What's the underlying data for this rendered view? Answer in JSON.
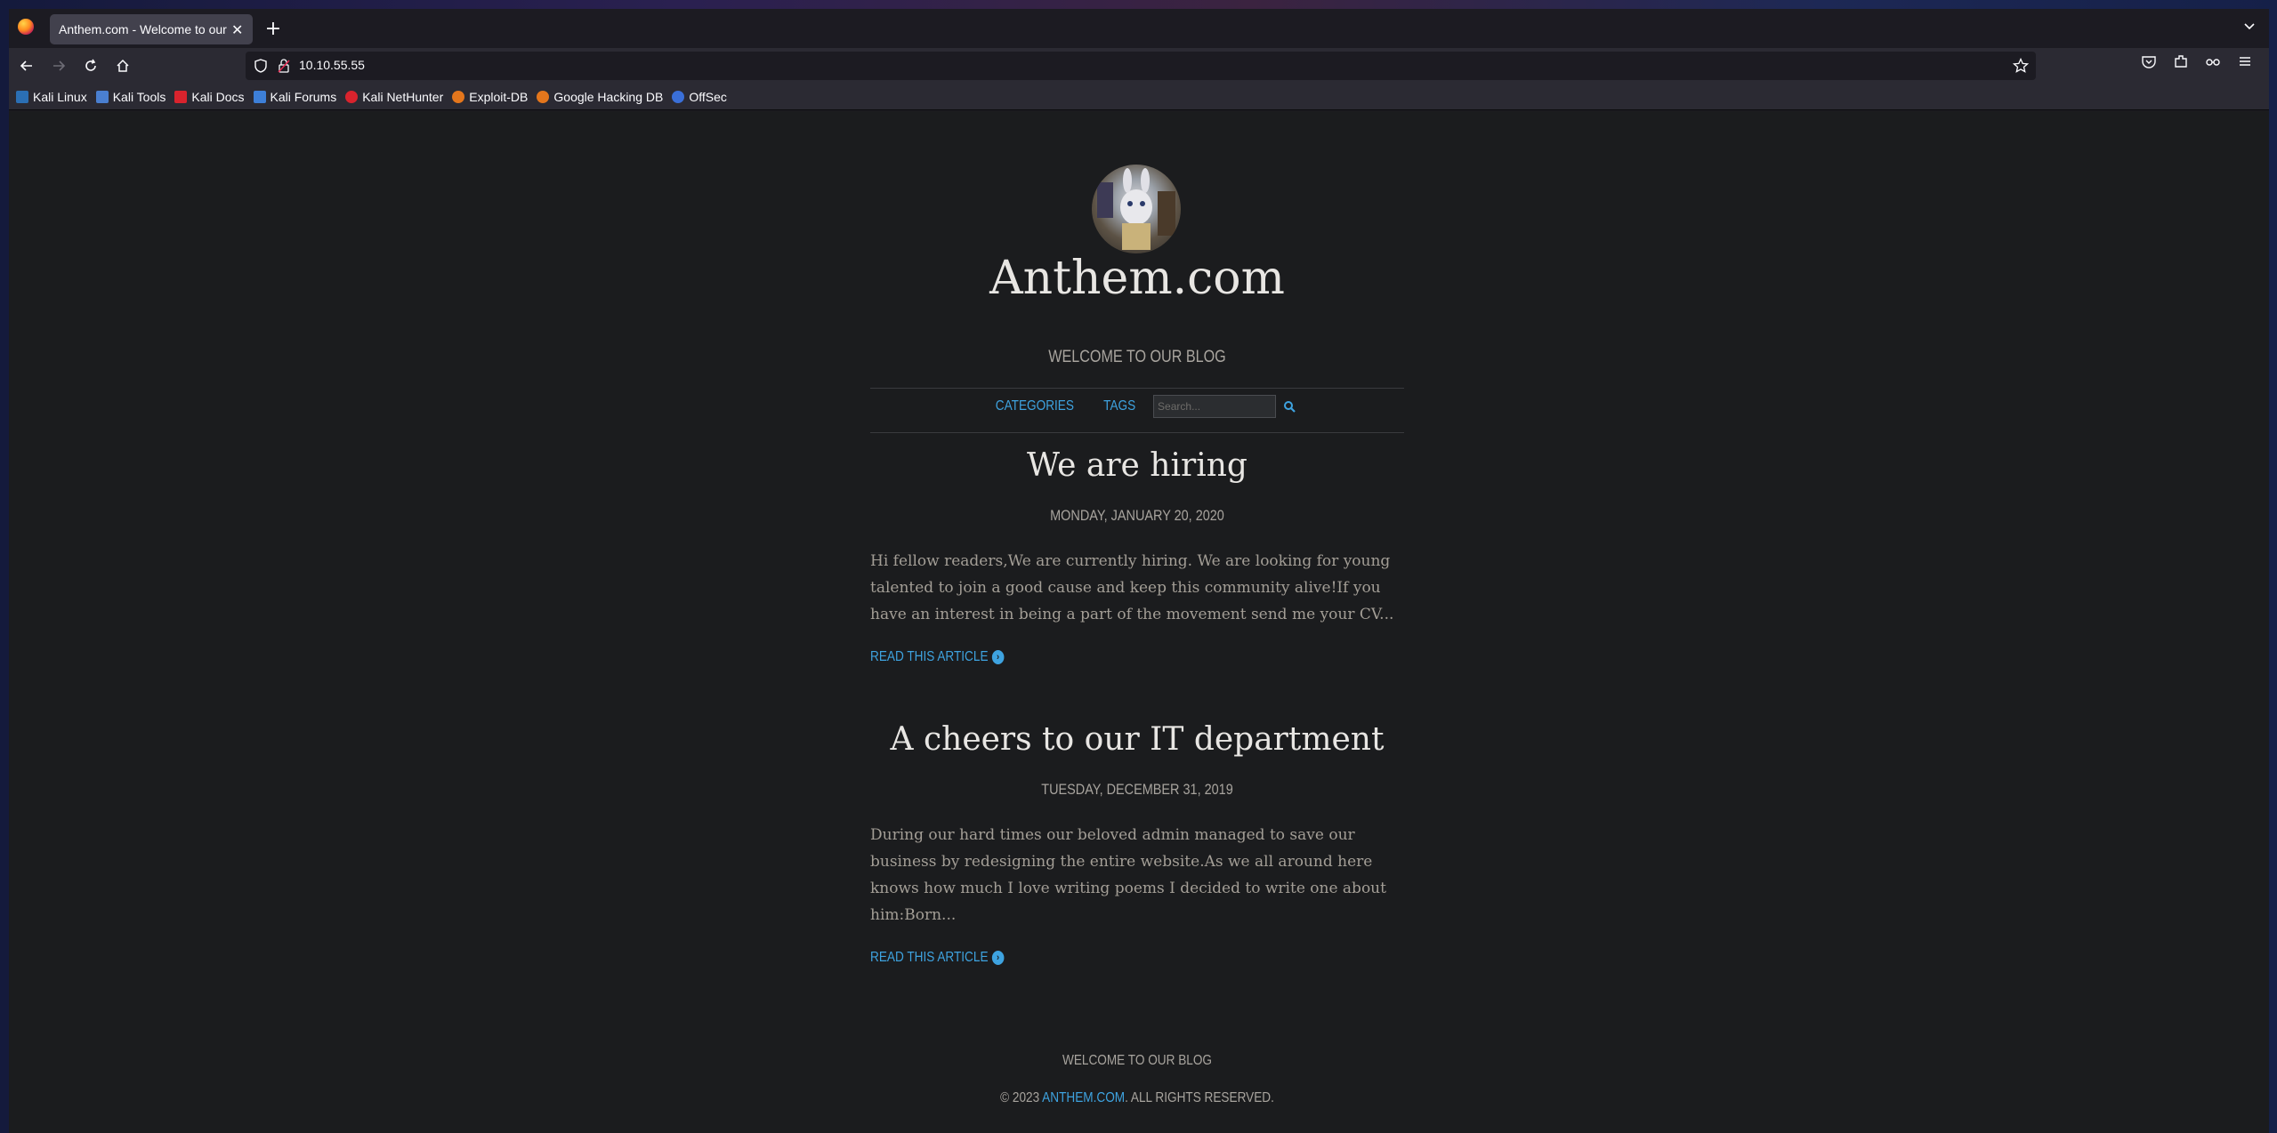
{
  "browser": {
    "tab_title": "Anthem.com - Welcome to our blog",
    "tab_close": "✕",
    "new_tab": "+",
    "url": "10.10.55.55",
    "bookmarks": [
      {
        "label": "Kali Linux",
        "color": "#2b6fb4"
      },
      {
        "label": "Kali Tools",
        "color": "#4a7fd0"
      },
      {
        "label": "Kali Docs",
        "color": "#d9232d"
      },
      {
        "label": "Kali Forums",
        "color": "#3d7fd8"
      },
      {
        "label": "Kali NetHunter",
        "color": "#d9232d"
      },
      {
        "label": "Exploit-DB",
        "color": "#e4761c"
      },
      {
        "label": "Google Hacking DB",
        "color": "#e4761c"
      },
      {
        "label": "OffSec",
        "color": "#3a6fd8"
      }
    ]
  },
  "site": {
    "title": "Anthem.com",
    "tagline": "WELCOME TO OUR BLOG",
    "menu": {
      "categories": "CATEGORIES",
      "tags": "TAGS",
      "search_placeholder": "Search..."
    }
  },
  "posts": [
    {
      "title": "We are hiring",
      "date": "MONDAY, JANUARY 20, 2020",
      "excerpt": "Hi fellow readers,We are currently hiring. We are looking for young talented to join a good cause and keep this community alive!If you have an interest in being a part of the movement send me your CV...",
      "read_more": "READ THIS ARTICLE"
    },
    {
      "title": "A cheers to our IT department",
      "date": "TUESDAY, DECEMBER 31, 2019",
      "excerpt": "During our hard times our beloved admin managed to save our business by redesigning the entire website.As we all around here knows how much I love writing poems I decided to write one about him:Born...",
      "read_more": "READ THIS ARTICLE"
    }
  ],
  "footer": {
    "tagline": "WELCOME TO OUR BLOG",
    "copyright_prefix": "© 2023 ",
    "copyright_link": "ANTHEM.COM",
    "copyright_suffix": ". ALL RIGHTS RESERVED."
  }
}
